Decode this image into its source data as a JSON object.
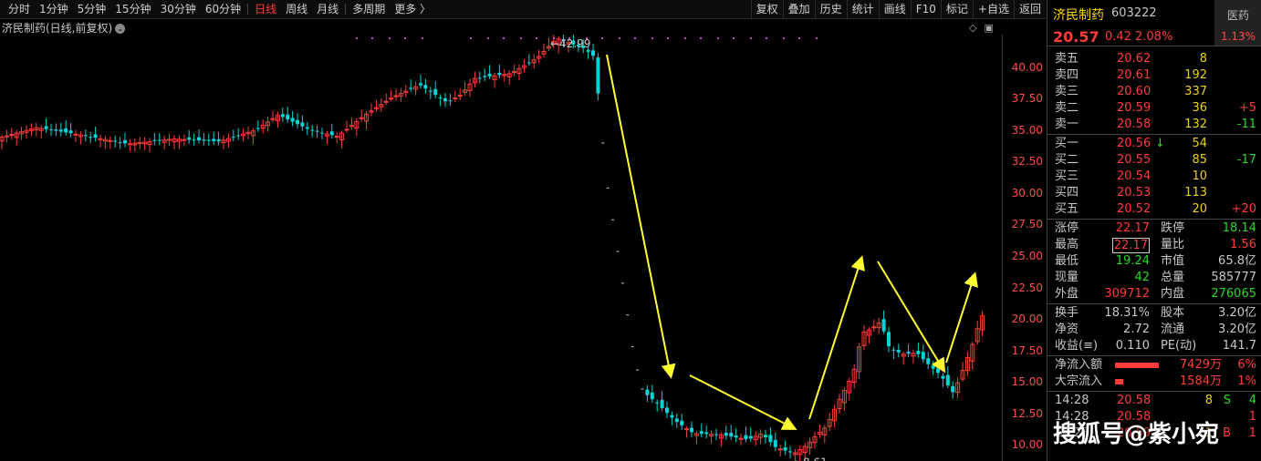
{
  "toolbar": {
    "periods": [
      "分时",
      "1分钟",
      "5分钟",
      "15分钟",
      "30分钟",
      "60分钟",
      "日线",
      "周线",
      "月线",
      "多周期",
      "更多 〉"
    ],
    "active": "日线",
    "buttons": [
      "复权",
      "叠加",
      "历史",
      "统计",
      "画线",
      "F10",
      "标记",
      "+自选",
      "返回"
    ]
  },
  "chart": {
    "title": "济民制药(日线,前复权)",
    "high_label": "42.99",
    "low_label": "8.61",
    "y_ticks": [
      "40.00",
      "37.50",
      "35.00",
      "32.50",
      "30.00",
      "27.50",
      "25.00",
      "22.50",
      "20.00",
      "17.50",
      "15.00",
      "12.50",
      "10.00"
    ],
    "up_color": "#ff3b3b",
    "down_color": "#00d4d4",
    "arrow_color": "#ffff30"
  },
  "chart_data": {
    "type": "candlestick",
    "title": "济民制药(日线,前复权)",
    "ylim": [
      9,
      43
    ],
    "y_ticks": [
      10,
      12.5,
      15,
      17.5,
      20,
      22.5,
      25,
      27.5,
      30,
      32.5,
      35,
      37.5,
      40
    ],
    "max_price": 42.99,
    "min_price": 8.61,
    "last_close": 20.57
  },
  "quote": {
    "name": "济民制药",
    "code": "603222",
    "sector": "医药",
    "sector_pct": "1.13%",
    "price": "20.57",
    "change": "0.42",
    "change_pct": "2.08%",
    "asks": [
      {
        "label": "卖五",
        "price": "20.62",
        "vol": "8",
        "delta": ""
      },
      {
        "label": "卖四",
        "price": "20.61",
        "vol": "192",
        "delta": ""
      },
      {
        "label": "卖三",
        "price": "20.60",
        "vol": "337",
        "delta": ""
      },
      {
        "label": "卖二",
        "price": "20.59",
        "vol": "36",
        "delta": "+5"
      },
      {
        "label": "卖一",
        "price": "20.58",
        "vol": "132",
        "delta": "-11"
      }
    ],
    "bids": [
      {
        "label": "买一",
        "price": "20.56",
        "vol": "54",
        "delta": ""
      },
      {
        "label": "买二",
        "price": "20.55",
        "vol": "85",
        "delta": "-17"
      },
      {
        "label": "买三",
        "price": "20.54",
        "vol": "10",
        "delta": ""
      },
      {
        "label": "买四",
        "price": "20.53",
        "vol": "113",
        "delta": ""
      },
      {
        "label": "买五",
        "price": "20.52",
        "vol": "20",
        "delta": "+20"
      }
    ],
    "stats": [
      {
        "l1": "涨停",
        "v1": "22.17",
        "l2": "跌停",
        "v2": "18.14"
      },
      {
        "l1": "最高",
        "v1": "22.17",
        "l2": "量比",
        "v2": "1.56"
      },
      {
        "l1": "最低",
        "v1": "19.24",
        "l2": "市值",
        "v2": "65.8亿"
      },
      {
        "l1": "现量",
        "v1": "42",
        "l2": "总量",
        "v2": "585777"
      },
      {
        "l1": "外盘",
        "v1": "309712",
        "l2": "内盘",
        "v2": "276065"
      }
    ],
    "stats2": [
      {
        "l1": "换手",
        "v1": "18.31%",
        "l2": "股本",
        "v2": "3.20亿"
      },
      {
        "l1": "净资",
        "v1": "2.72",
        "l2": "流通",
        "v2": "3.20亿"
      },
      {
        "l1": "收益(≡)",
        "v1": "0.110",
        "l2": "PE(动)",
        "v2": "141.7"
      }
    ],
    "flows": [
      {
        "label": "净流入额",
        "amount": "7429万",
        "pct": "6%",
        "bar": 0.8
      },
      {
        "label": "大宗流入",
        "amount": "1584万",
        "pct": "1%",
        "bar": 0.15
      }
    ],
    "ticks": [
      {
        "time": "14:28",
        "price": "20.58",
        "vol": "8",
        "side": "S",
        "n": "4"
      },
      {
        "time": "14:28",
        "price": "20.58",
        "vol": "",
        "side": "",
        "n": "1"
      },
      {
        "time": "14:28",
        "price": "20.59",
        "vol": "1",
        "side": "B",
        "n": "1"
      }
    ]
  },
  "watermark": "搜狐号@紫小宛"
}
